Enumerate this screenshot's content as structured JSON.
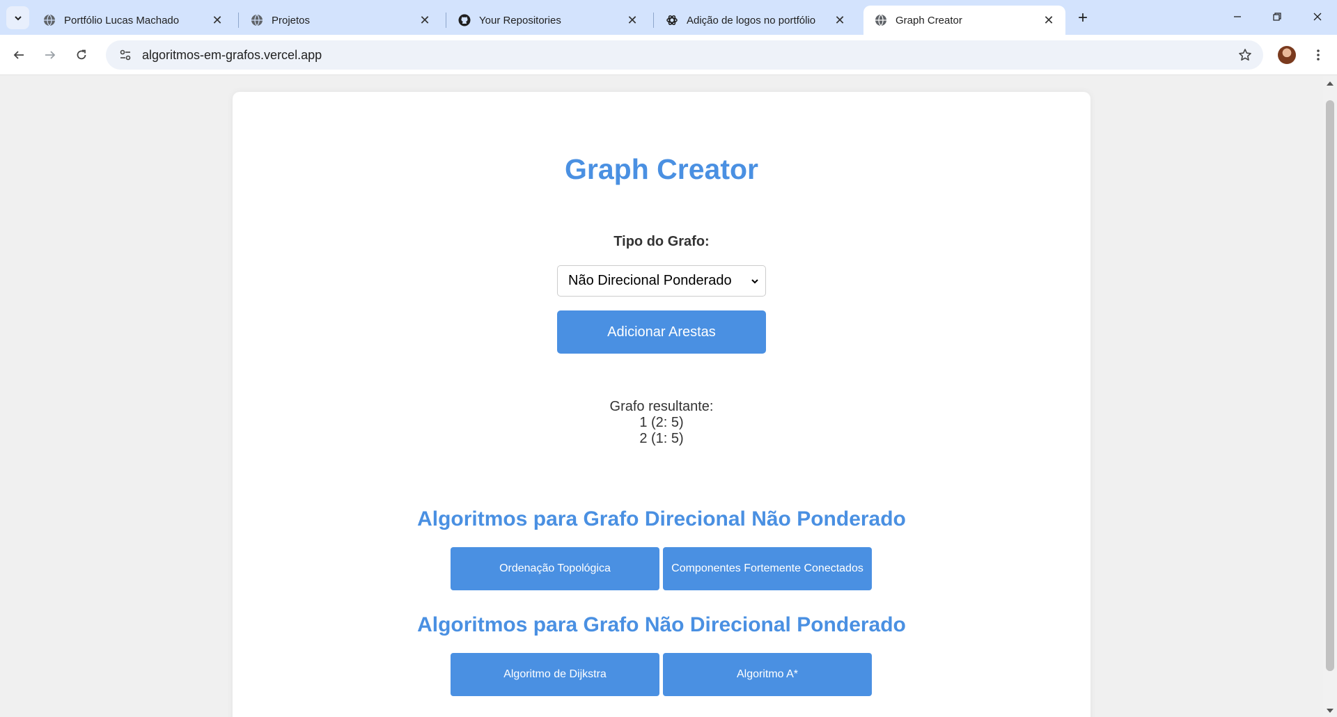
{
  "browser": {
    "tabs": [
      {
        "label": "Portfólio Lucas Machado",
        "favicon": "globe-icon",
        "active": false
      },
      {
        "label": "Projetos",
        "favicon": "globe-icon",
        "active": false
      },
      {
        "label": "Your Repositories",
        "favicon": "github-icon",
        "active": false
      },
      {
        "label": "Adição de logos no portfólio",
        "favicon": "openai-icon",
        "active": false
      },
      {
        "label": "Graph Creator",
        "favicon": "globe-icon",
        "active": true
      }
    ],
    "url": "algoritmos-em-grafos.vercel.app"
  },
  "page": {
    "title": "Graph Creator",
    "graph_type_label": "Tipo do Grafo:",
    "graph_type_selected": "Não Direcional Ponderado",
    "add_edges_label": "Adicionar Arestas",
    "result": {
      "heading": "Grafo resultante:",
      "lines": [
        "1 (2: 5)",
        "2 (1: 5)"
      ]
    },
    "sections": [
      {
        "title": "Algoritmos para Grafo Direcional Não Ponderado",
        "buttons": [
          "Ordenação Topológica",
          "Componentes Fortemente Conectados"
        ]
      },
      {
        "title": "Algoritmos para Grafo Não Direcional Ponderado",
        "buttons": [
          "Algoritmo de Dijkstra",
          "Algoritmo A*"
        ]
      }
    ]
  },
  "colors": {
    "accent": "#4a90e2",
    "tabbar": "#d3e3fd",
    "text": "#333333"
  }
}
